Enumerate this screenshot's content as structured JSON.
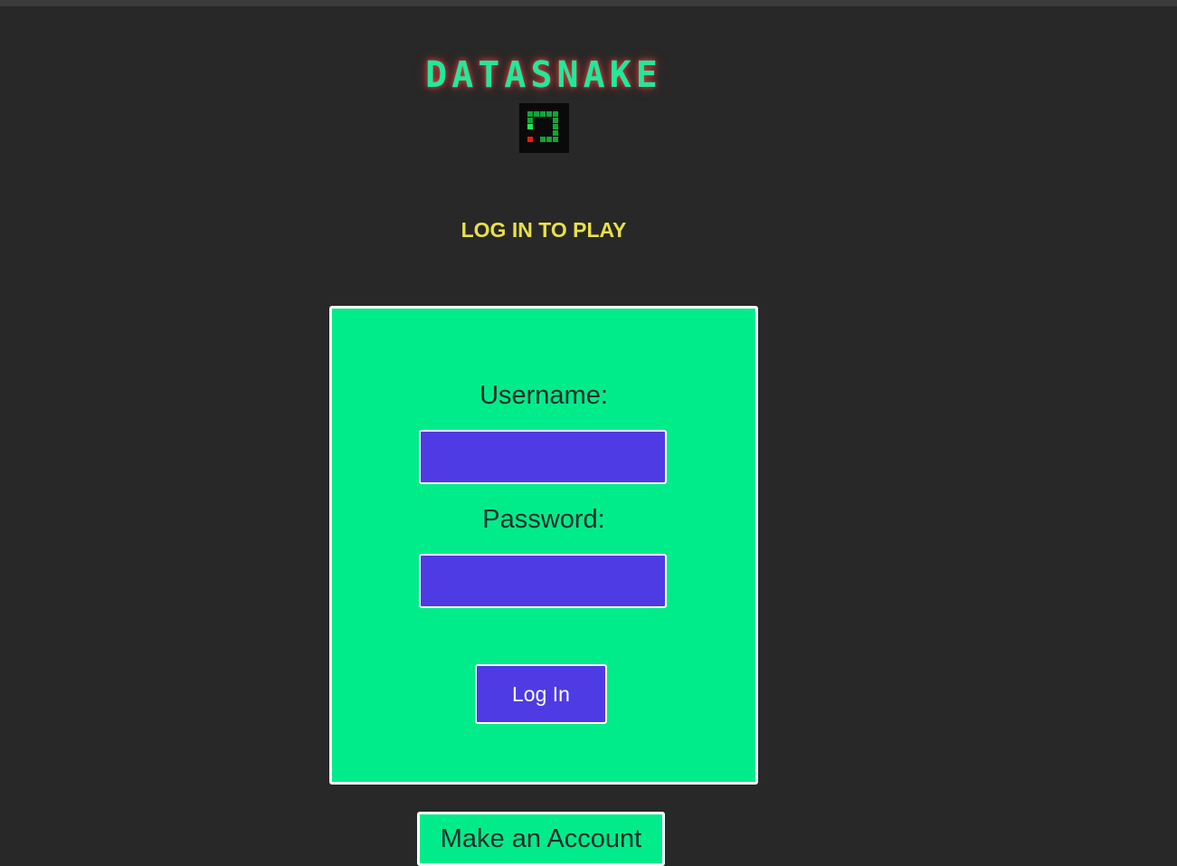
{
  "app": {
    "title": "DATASNAKE"
  },
  "header": {
    "logo_icon": "snake-game-icon",
    "subtitle": "LOG IN TO PLAY"
  },
  "login_form": {
    "username_label": "Username:",
    "username_value": "",
    "password_label": "Password:",
    "password_value": "",
    "submit_label": "Log In"
  },
  "footer": {
    "make_account_label": "Make an Account"
  },
  "colors": {
    "background": "#282828",
    "accent_green": "#00ec8b",
    "title_green": "#22e89a",
    "title_glow": "#e53c3c",
    "subtitle_yellow": "#e8e04a",
    "input_purple": "#4f3be3",
    "border_white": "#ffffff"
  }
}
